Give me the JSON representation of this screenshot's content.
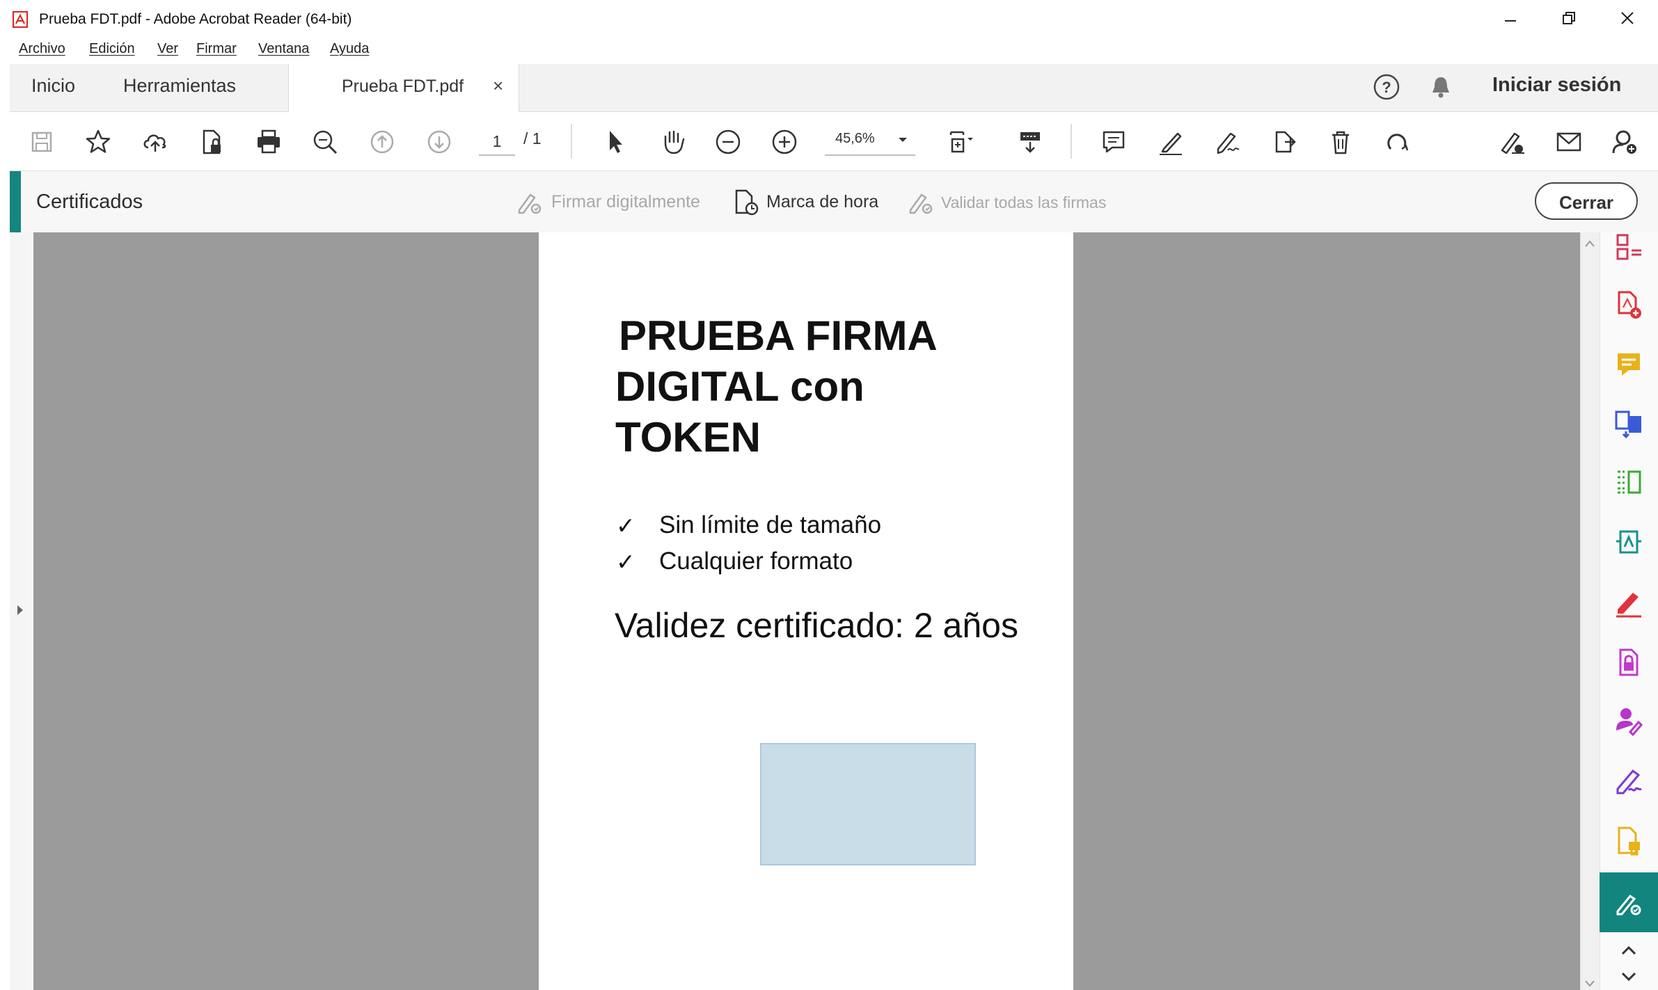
{
  "window": {
    "title": "Prueba FDT.pdf - Adobe Acrobat Reader (64-bit)",
    "app_icon": "acrobat-icon",
    "controls": [
      "minimize-icon",
      "restore-icon",
      "close-icon"
    ]
  },
  "menu": {
    "items": [
      "Archivo",
      "Edición",
      "Ver",
      "Firmar",
      "Ventana",
      "Ayuda"
    ]
  },
  "tabs": {
    "home": "Inicio",
    "tools": "Herramientas",
    "document": "Prueba FDT.pdf",
    "close_glyph": "×",
    "help_icon": "help-icon",
    "bell_icon": "bell-icon",
    "sign_in": "Iniciar sesión"
  },
  "toolbar": {
    "page_current": "1",
    "page_total": "/ 1",
    "zoom": "45,6%",
    "icons": [
      "save-icon",
      "bookmark-star-icon",
      "upload-cloud-icon",
      "file-lock-icon",
      "print-icon",
      "zoom-find-icon",
      "prev-page-icon",
      "next-page-icon",
      "select-cursor-icon",
      "hand-tool-icon",
      "zoom-out-icon",
      "zoom-in-icon",
      "fit-page-icon",
      "scroll-mode-icon",
      "comment-icon",
      "highlight-icon",
      "fill-sign-icon",
      "share-icon",
      "delete-icon",
      "rotate-icon",
      "sign-request-icon",
      "email-icon",
      "account-icon"
    ]
  },
  "certificates": {
    "title": "Certificados",
    "sign_digitally": "Firmar digitalmente",
    "timestamp": "Marca de hora",
    "validate_all": "Validar todas las firmas",
    "close": "Cerrar"
  },
  "document": {
    "title_line1": "PRUEBA FIRMA",
    "title_line2": "DIGITAL con",
    "title_line3": "TOKEN",
    "check_glyph": "✓",
    "bullets": [
      "Sin límite de tamaño",
      "Cualquier formato"
    ],
    "validity": "Validez certificado: 2 años"
  },
  "right_panel": {
    "icons": [
      "organize-pages-icon",
      "create-pdf-icon",
      "comment-tool-icon",
      "export-pdf-icon",
      "compare-files-icon",
      "edit-pdf-icon",
      "fill-sign-tool-icon",
      "protect-icon",
      "request-signature-icon",
      "signature-tool-icon",
      "stamp-tool-icon",
      "certificates-tool-icon",
      "scroll-up-icon",
      "scroll-down-icon"
    ],
    "colors": {
      "organize": "#d23a5a",
      "create": "#e0333b",
      "comment": "#e8b21a",
      "export": "#3a5bd8",
      "compare": "#3aaa35",
      "edit": "#17928a",
      "fill_sign": "#e0333b",
      "protect": "#c23acb",
      "request": "#b536c8",
      "signature": "#7a3ad0",
      "stamp": "#e8b21a",
      "active_bg": "#12857f"
    }
  },
  "accent": "#14857f"
}
